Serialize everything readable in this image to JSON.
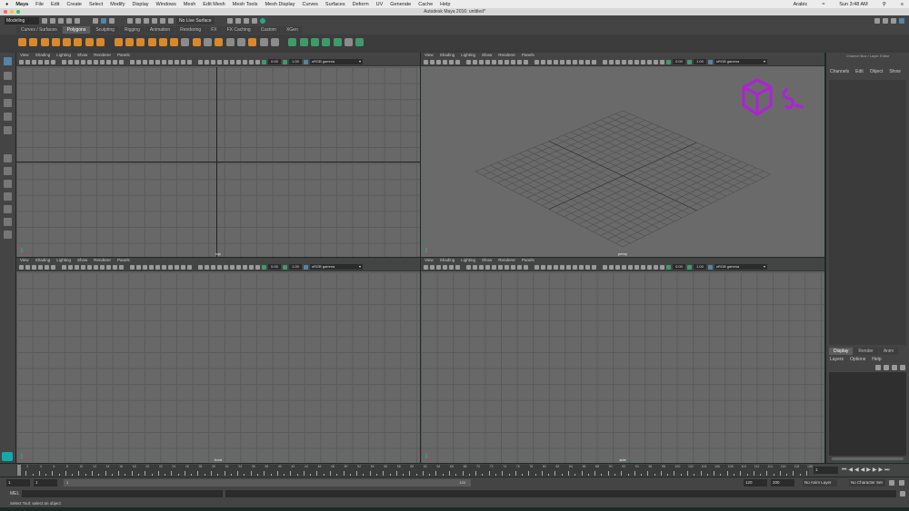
{
  "menubar": {
    "apple": "",
    "app": "Maya",
    "items": [
      "File",
      "Edit",
      "Create",
      "Select",
      "Modify",
      "Display",
      "Windows",
      "Mesh",
      "Edit Mesh",
      "Mesh Tools",
      "Mesh Display",
      "Curves",
      "Surfaces",
      "Deform",
      "UV",
      "Generate",
      "Cache",
      "Help"
    ],
    "input_source": "Arabic",
    "clock": "Sun 3:48 AM"
  },
  "window": {
    "title": "Autodesk Maya 2016: untitled*"
  },
  "statusline": {
    "mode": "Modeling",
    "live_surface": "No Live Surface"
  },
  "shelf": {
    "tabs": [
      "Curves / Surfaces",
      "Polygons",
      "Sculpting",
      "Rigging",
      "Animation",
      "Rendering",
      "FX",
      "FX Caching",
      "Custom",
      "XGen"
    ],
    "active": "Polygons"
  },
  "viewport_menu": [
    "View",
    "Shading",
    "Lighting",
    "Show",
    "Renderer",
    "Panels"
  ],
  "viewport_toolbar": {
    "exposure": "0.00",
    "gamma": "1.00",
    "color_space": "sRGB gamma"
  },
  "viewports": [
    {
      "label": "top"
    },
    {
      "label": "persp"
    },
    {
      "label": "front"
    },
    {
      "label": "side"
    }
  ],
  "channel_box": {
    "title": "Channel Box / Layer Editor",
    "menu": [
      "Channels",
      "Edit",
      "Object",
      "Show"
    ]
  },
  "layer_editor": {
    "tabs": [
      "Display",
      "Render",
      "Anim"
    ],
    "active": "Display",
    "menu": [
      "Layers",
      "Options",
      "Help"
    ]
  },
  "time": {
    "start": 1,
    "end": 120,
    "current": "1",
    "range_start": "1",
    "playback_start": "1",
    "range_inner_start": "1",
    "range_inner_end": "120",
    "playback_end": "120",
    "anim_end": "200",
    "anim_layer": "No Anim Layer",
    "character_set": "No Character Set"
  },
  "command_line": {
    "label": "MEL"
  },
  "help_line": "Select Tool: select an object",
  "colors": {
    "accent": "#5285a6",
    "shelf_icon": "#d9882c",
    "logo": "#b020d8"
  }
}
